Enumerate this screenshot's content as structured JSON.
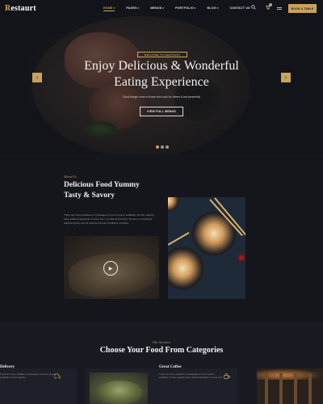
{
  "brand": {
    "logo_first": "R",
    "logo_rest": "estaurt",
    "accent": "#c9a35b"
  },
  "nav": {
    "items": [
      {
        "label": "HOME",
        "caret": "▾",
        "active": true
      },
      {
        "label": "PAGES",
        "caret": "▾"
      },
      {
        "label": "MENUS",
        "caret": "▾"
      },
      {
        "label": "PORTFOLIO",
        "caret": "▾"
      },
      {
        "label": "BLOG",
        "caret": "▾"
      },
      {
        "label": "CONTACT US",
        "caret": ""
      }
    ],
    "icons": {
      "search": "search-icon",
      "cart": "cart-icon",
      "menu": "hamburger-icon"
    },
    "book_button": "BOOK A TABLE"
  },
  "hero": {
    "tag": "WELCOME TO RESTAURT",
    "title_line1": "Enjoy Delicious & Wonderful",
    "title_line2": "Eating Experience",
    "subtitle": "Good things come to those who cook for others & eat peacefully",
    "button": "VIEW FULL MENUS",
    "arrow_prev": "‹",
    "arrow_next": "›",
    "slides": 3,
    "active_slide": 1
  },
  "about": {
    "label": "About Us",
    "title_line1": "Delicious Food Yummy",
    "title_line2": "Tasty & Savory",
    "text": "There are many variations of passages of Lorem Ipsum available, but the majority have suffered alteration in some form, by injected humour. Sit amet, consectetur adipisicing elit, sed do eiusmod tempor incididunt ut labore.",
    "play_icon": "▶"
  },
  "services": {
    "label": "Our Services",
    "title": "Choose Your Food From Categories",
    "cards": [
      {
        "title": "Delivery",
        "text": "There are many variations of passages of Lorem Ipsum available, but the majority",
        "icon": "delivery-icon"
      },
      {
        "title": "Great Coffee",
        "text": "There are many variations of passages of Lorem Ipsum available, but the majority have suffered alteration in some form",
        "icon": "coffee-icon"
      }
    ]
  }
}
